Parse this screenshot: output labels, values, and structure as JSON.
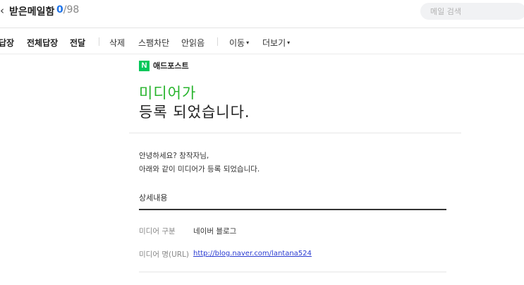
{
  "header": {
    "back_icon": "chevron-left-icon",
    "back_glyph": "‹",
    "title": "받은메일함",
    "unread": "0",
    "separator": "/",
    "total": "98",
    "search_placeholder": "메일 검색"
  },
  "toolbar": {
    "reply": "답장",
    "reply_all": "전체답장",
    "forward": "전달",
    "delete": "삭제",
    "block_spam": "스팸차단",
    "mark_unread": "안읽음",
    "move": "이동",
    "more": "더보기",
    "caret": "▾"
  },
  "mail": {
    "logo_letter": "N",
    "logo_text": "애드포스트",
    "headline_line1": "미디어가",
    "headline_line2": "등록 되었습니다.",
    "intro_line1": "안녕하세요? 창작자님,",
    "intro_line2": "아래와 같이 미디어가 등록 되었습니다.",
    "section_title": "상세내용",
    "details": [
      {
        "label": "미디어 구분",
        "value": "네이버 블로그"
      },
      {
        "label": "미디어 명(URL)",
        "value": "http://blog.naver.com/lantana524"
      }
    ]
  },
  "colors": {
    "accent_blue": "#1e73e8",
    "naver_green": "#03c75a",
    "headline_green": "#28b42d",
    "link": "#2a3bd1"
  }
}
